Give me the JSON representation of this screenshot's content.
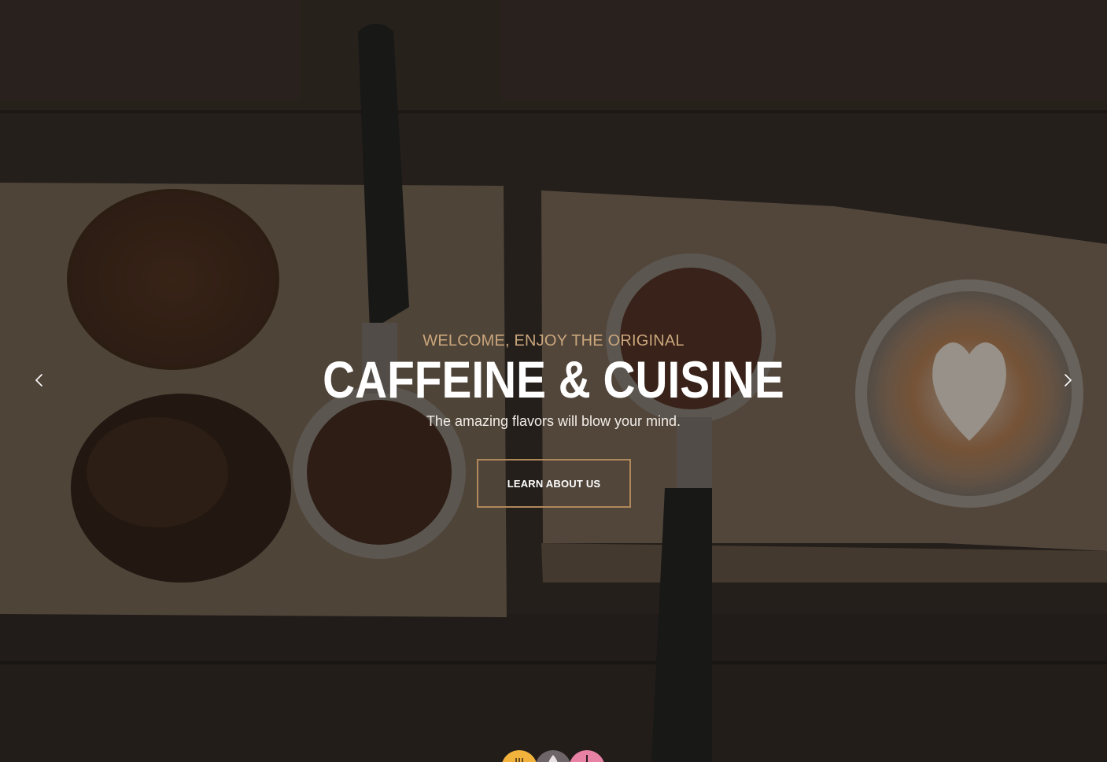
{
  "hero": {
    "kicker": "WELCOME, ENJOY THE ORIGINAL",
    "headline": "CAFFEINE & CUISINE",
    "tagline": "The amazing flavors will blow your mind.",
    "button_label": "LEARN ABOUT US",
    "background_icon": "coffee-table-photo",
    "prev_icon": "chevron-left-icon",
    "next_icon": "chevron-right-icon"
  },
  "badges": {
    "items": [
      {
        "icon": "utensils-icon",
        "color": "#f2b33d"
      },
      {
        "icon": "coffee-drop-icon",
        "color": "#6e6568"
      },
      {
        "icon": "wine-glass-icon",
        "color": "#e882a5"
      }
    ]
  },
  "colors": {
    "accent": "#caa67c",
    "button_border": "#b0885a",
    "heading": "#ffffff"
  }
}
